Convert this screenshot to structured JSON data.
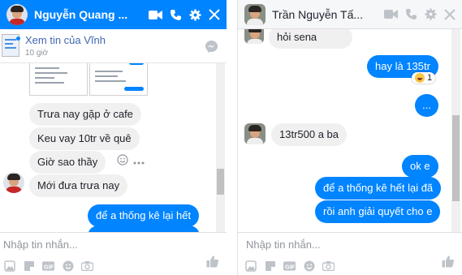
{
  "chat1": {
    "contact_name": "Nguyễn Quang ...",
    "header_icons": [
      "video-camera-icon",
      "phone-icon",
      "gear-icon",
      "close-icon"
    ],
    "shared_link": "Xem tin của Vĩnh",
    "shared_time": "10 giờ",
    "messages": [
      {
        "dir": "in",
        "text": "Trưa nay gặp ở cafe"
      },
      {
        "dir": "in",
        "text": "Keu vay 10tr về quê"
      },
      {
        "dir": "in",
        "text": "Giờ sao thầy"
      },
      {
        "dir": "in",
        "text": "Mới đưa trưa nay"
      },
      {
        "dir": "out",
        "text": "để a thống kê lại hết"
      }
    ],
    "input_placeholder": "Nhập tin nhắn...",
    "accent": "#0084ff"
  },
  "chat2": {
    "contact_name": "Trần Nguyễn Tấ...",
    "header_icons": [
      "video-camera-icon",
      "phone-icon",
      "gear-icon",
      "close-icon"
    ],
    "messages": [
      {
        "dir": "in",
        "text": "hỏi sena"
      },
      {
        "dir": "out",
        "text": "hay là 135tr"
      },
      {
        "dir": "out",
        "text": "..."
      },
      {
        "dir": "in",
        "text": "13tr500 a ba"
      },
      {
        "dir": "out",
        "text": "ok e"
      },
      {
        "dir": "out",
        "text": "để a thống kê hết lại đã"
      },
      {
        "dir": "out",
        "text": "rồi anh giải quyết cho e"
      }
    ],
    "reaction": {
      "icon": "haha-emoji-icon",
      "count": "1"
    },
    "input_placeholder": "Nhập tin nhắn...",
    "accent": "#0084ff"
  },
  "toolbar_icons": [
    "photo-icon",
    "sticker-icon",
    "gif-icon",
    "emoji-icon",
    "camera-icon",
    "like-icon"
  ]
}
